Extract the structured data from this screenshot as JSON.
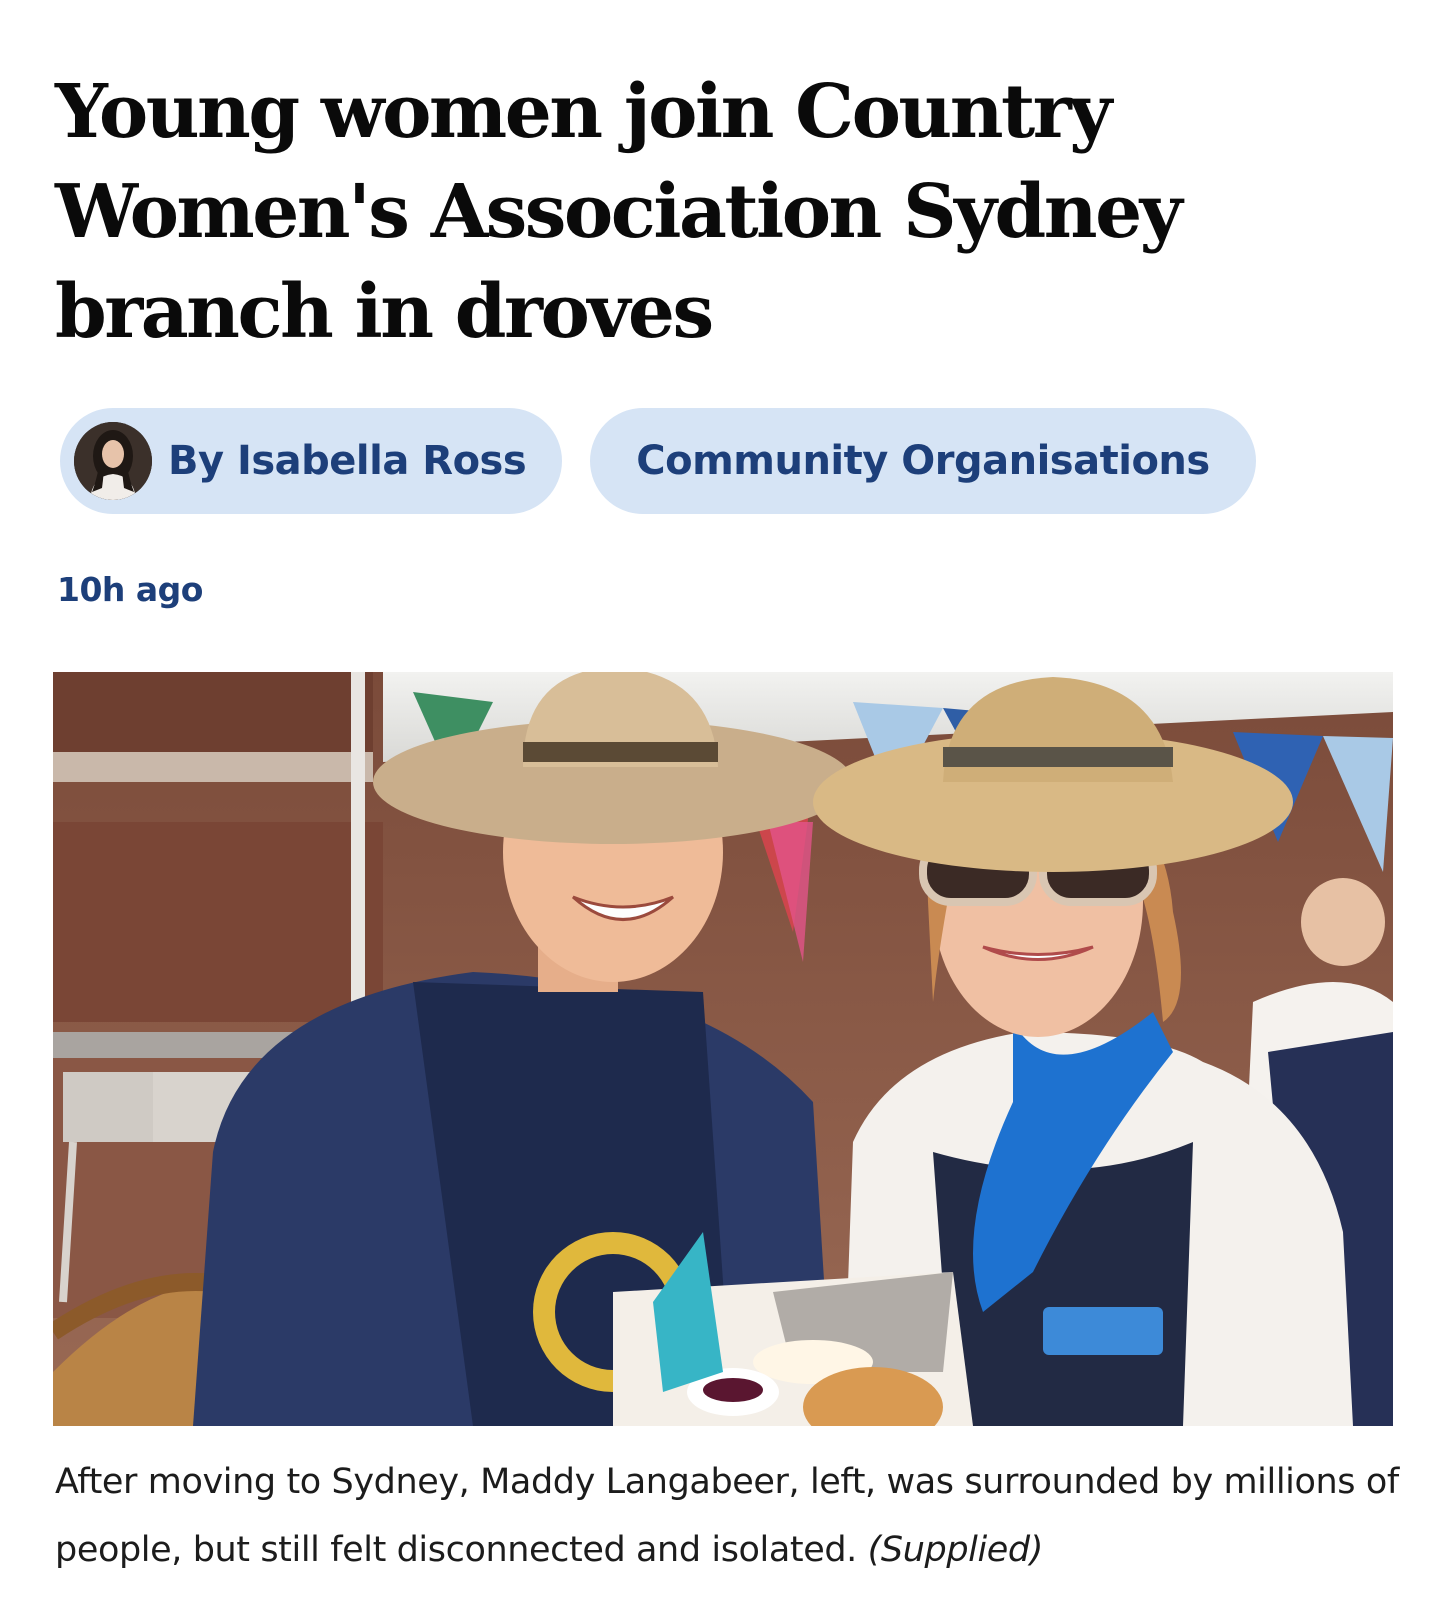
{
  "article": {
    "headline": "Young women join Country Women's Association Sydney branch in droves",
    "byline": "By Isabella Ross",
    "topic": "Community Organisations",
    "published": "10h ago",
    "image_caption": "After moving to Sydney, Maddy Langabeer, left, was surrounded by millions of people, but still felt disconnected and isolated.",
    "image_credit": "(Supplied)"
  },
  "colors": {
    "pill_background": "#d6e4f5",
    "link_text": "#1d3f7a",
    "headline_text": "#0a0a0a"
  },
  "icons": {
    "author_avatar": "author-avatar",
    "hero_image": "hero-photo"
  }
}
